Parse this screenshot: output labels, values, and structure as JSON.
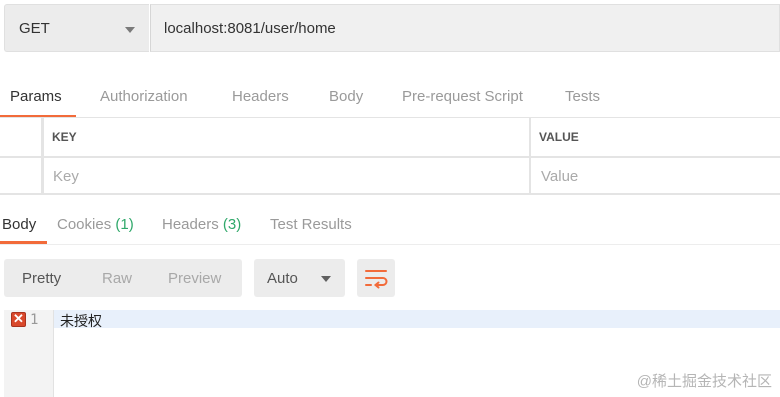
{
  "request": {
    "method": "GET",
    "url": "localhost:8081/user/home"
  },
  "request_tabs": [
    {
      "label": "Params",
      "active": true
    },
    {
      "label": "Authorization"
    },
    {
      "label": "Headers"
    },
    {
      "label": "Body"
    },
    {
      "label": "Pre-request Script"
    },
    {
      "label": "Tests"
    }
  ],
  "params_table": {
    "headers": [
      "KEY",
      "VALUE"
    ],
    "placeholders": {
      "key": "Key",
      "value": "Value"
    }
  },
  "response_tabs": {
    "body": "Body",
    "cookies": "Cookies",
    "cookies_count": "(1)",
    "headers": "Headers",
    "headers_count": "(3)",
    "test_results": "Test Results"
  },
  "view_modes": [
    "Pretty",
    "Raw",
    "Preview"
  ],
  "format_select": "Auto",
  "response_body": {
    "line_number": "1",
    "text": "未授权"
  },
  "watermark": "@稀土掘金技术社区",
  "colors": {
    "accent": "#f26b3a",
    "count": "#2fa86a",
    "error": "#d9482b"
  }
}
